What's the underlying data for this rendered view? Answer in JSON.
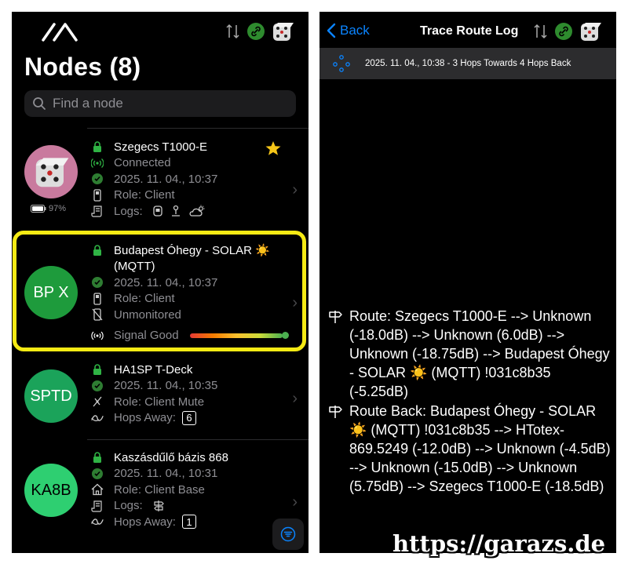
{
  "left": {
    "title": "Nodes (8)",
    "search_placeholder": "Find a node",
    "nodes": [
      {
        "short": "",
        "name": "Szegecs T1000-E",
        "status": "Connected",
        "time": "2025. 11. 04., 10:37",
        "role": "Role: Client",
        "logs_label": "Logs:",
        "battery": "97%",
        "favorite": true,
        "avatar_color": "#c97a9e"
      },
      {
        "short": "BP X",
        "name": "Budapest Óhegy - SOLAR ☀️",
        "name2": "(MQTT)",
        "time": "2025. 11. 04., 10:37",
        "role": "Role: Client",
        "monitor": "Unmonitored",
        "signal": "Signal Good",
        "avatar_color": "#1e9b3c"
      },
      {
        "short": "SPTD",
        "name": "HA1SP T-Deck",
        "time": "2025. 11. 04., 10:35",
        "role": "Role: Client Mute",
        "hops_label": "Hops Away:",
        "hops": "6",
        "avatar_color": "#1ba35a"
      },
      {
        "short": "KA8B",
        "name": "Kaszásdűlő bázis 868",
        "time": "2025. 11. 04., 10:31",
        "role": "Role: Client Base",
        "logs_label": "Logs:",
        "hops_label": "Hops Away:",
        "hops": "1",
        "avatar_color": "#2ecf71"
      }
    ]
  },
  "right": {
    "back_label": "Back",
    "title": "Trace Route Log",
    "log_entry": "2025. 11. 04., 10:38 - 3 Hops Towards  4 Hops Back",
    "route": "Route: Szegecs T1000-E --> Unknown (-18.0dB) --> Unknown (6.0dB) --> Unknown (-18.75dB) --> Budapest Óhegy - SOLAR ☀️ (MQTT) !031c8b35 (-5.25dB)",
    "route_back": "Route Back: Budapest Óhegy - SOLAR ☀️ (MQTT) !031c8b35 --> HTotex-869.5249 (-12.0dB) --> Unknown (-4.5dB) --> Unknown (-15.0dB) --> Unknown (5.75dB) --> Szegecs T1000-E (-18.5dB)"
  },
  "watermark": "https://garazs.de",
  "colors": {
    "accent": "#0a84ff",
    "highlight": "#f5ea14",
    "link_green": "#2e8b2e"
  }
}
